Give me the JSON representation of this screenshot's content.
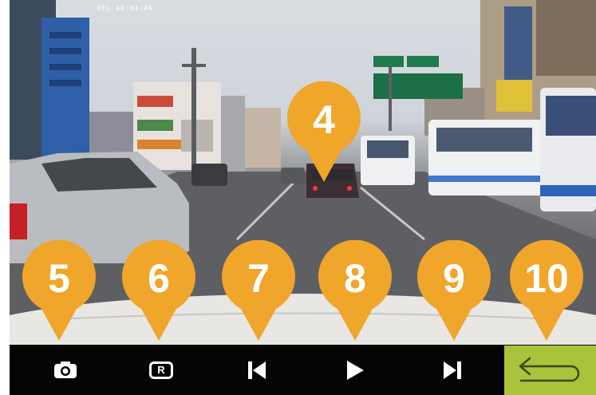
{
  "screen": {
    "timestamp": "REC 00:04:40"
  },
  "controls": {
    "snapshot": {
      "icon": "camera-icon"
    },
    "record": {
      "icon": "record-icon",
      "label": "R"
    },
    "previous": {
      "icon": "skip-previous-icon"
    },
    "play": {
      "icon": "play-icon"
    },
    "next": {
      "icon": "skip-next-icon"
    },
    "back": {
      "icon": "return-arrow-icon"
    }
  },
  "callouts": [
    {
      "number": "4",
      "target": "video-view"
    },
    {
      "number": "5",
      "target": "snapshot-button"
    },
    {
      "number": "6",
      "target": "record-button"
    },
    {
      "number": "7",
      "target": "previous-button"
    },
    {
      "number": "8",
      "target": "play-button"
    },
    {
      "number": "9",
      "target": "next-button"
    },
    {
      "number": "10",
      "target": "back-button"
    }
  ],
  "colors": {
    "callout": "#f0a52b",
    "back_button": "#a9c33a",
    "control_bar": "#050505"
  }
}
